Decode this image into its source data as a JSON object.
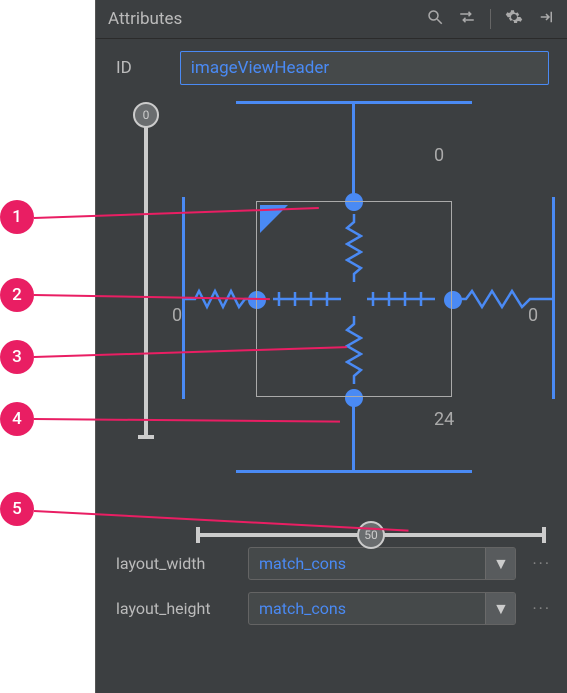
{
  "panel": {
    "title": "Attributes"
  },
  "id": {
    "label": "ID",
    "value": "imageViewHeader"
  },
  "constraints": {
    "margin_top": "0",
    "margin_bottom": "24",
    "margin_left": "0",
    "margin_right": "0"
  },
  "bias": {
    "vertical": "0",
    "horizontal": "50"
  },
  "attrs": {
    "layout_width": {
      "label": "layout_width",
      "value": "match_cons"
    },
    "layout_height": {
      "label": "layout_height",
      "value": "match_cons"
    }
  },
  "callouts": [
    "1",
    "2",
    "3",
    "4",
    "5"
  ]
}
